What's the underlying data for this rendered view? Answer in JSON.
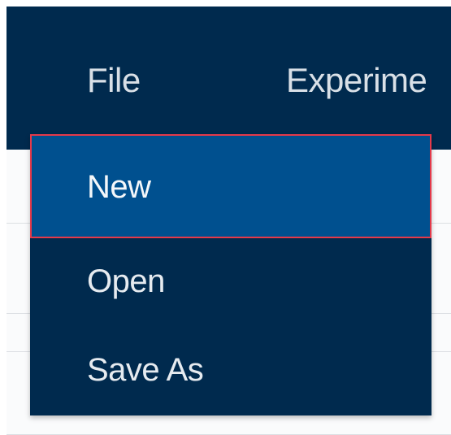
{
  "menubar": {
    "items": [
      {
        "label": "File"
      },
      {
        "label": "Experime"
      }
    ]
  },
  "dropdown": {
    "items": [
      {
        "label": "New",
        "state": "highlighted"
      },
      {
        "label": "Open"
      },
      {
        "label": "Save As"
      }
    ]
  },
  "colors": {
    "menubar_bg": "#002a4e",
    "highlight_bg": "#00508f",
    "highlight_border": "#e5394a",
    "menu_text": "#d9e0e7"
  }
}
